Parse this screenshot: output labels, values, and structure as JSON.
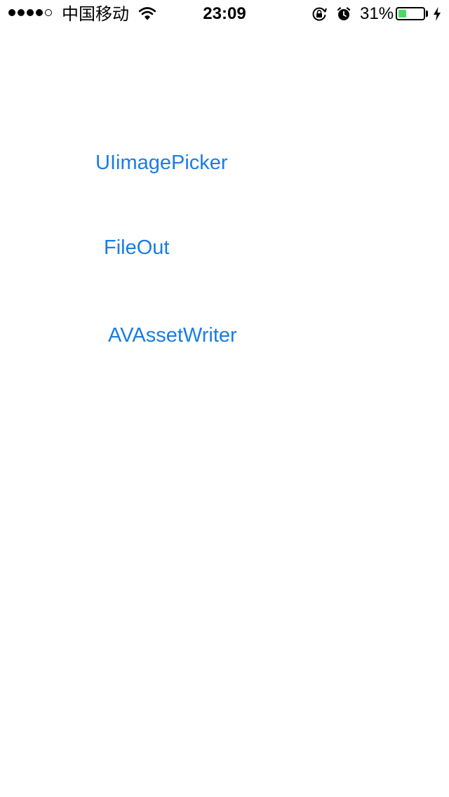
{
  "status_bar": {
    "signal_bars_filled": 4,
    "signal_bars_total": 5,
    "carrier": "中国移动",
    "time": "23:09",
    "battery_percent_label": "31%",
    "battery_level": 0.31,
    "battery_color": "#4cd964",
    "icons": [
      "wifi-icon",
      "rotation-lock-icon",
      "alarm-icon",
      "battery-icon",
      "charging-bolt-icon"
    ]
  },
  "menu": {
    "accent_color": "#1a7de3",
    "items": [
      {
        "label": "UIimagePicker"
      },
      {
        "label": "FileOut"
      },
      {
        "label": "AVAssetWriter"
      }
    ]
  }
}
